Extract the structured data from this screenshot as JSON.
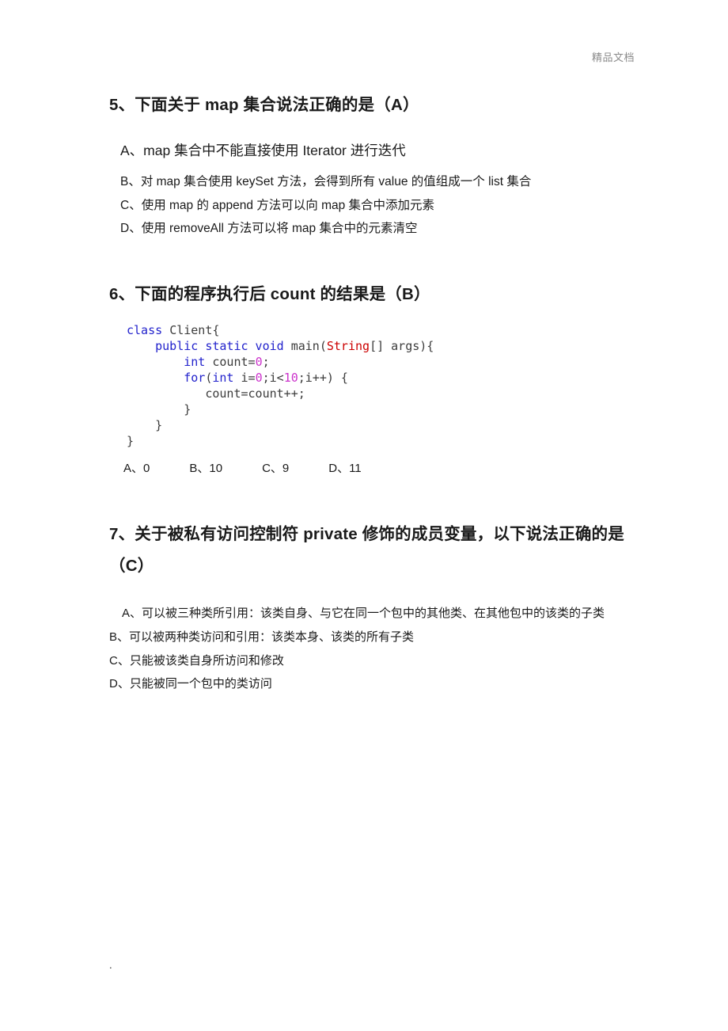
{
  "document": {
    "header_watermark": "精品文档",
    "footer_mark": "."
  },
  "questions": [
    {
      "id": "q5",
      "heading": "5、下面关于 map 集合说法正确的是（A）",
      "answer_key": "A",
      "options": [
        "A、map 集合中不能直接使用 Iterator 进行迭代",
        "B、对 map 集合使用 keySet 方法，会得到所有 value 的值组成一个 list 集合",
        "C、使用 map 的 append 方法可以向 map 集合中添加元素",
        "D、使用 removeAll 方法可以将 map 集合中的元素清空"
      ]
    },
    {
      "id": "q6",
      "heading": "6、下面的程序执行后 count 的结果是（B）",
      "answer_key": "B",
      "code": {
        "language": "java",
        "lines": [
          [
            {
              "t": "class ",
              "c": "kw"
            },
            {
              "t": "Client{",
              "c": "pln"
            }
          ],
          [
            {
              "t": "    ",
              "c": "pln"
            },
            {
              "t": "public static void ",
              "c": "kw"
            },
            {
              "t": "main(",
              "c": "pln"
            },
            {
              "t": "String",
              "c": "type"
            },
            {
              "t": "[] args){",
              "c": "pln"
            }
          ],
          [
            {
              "t": "        ",
              "c": "pln"
            },
            {
              "t": "int ",
              "c": "kw"
            },
            {
              "t": "count=",
              "c": "pln"
            },
            {
              "t": "0",
              "c": "num"
            },
            {
              "t": ";",
              "c": "pln"
            }
          ],
          [
            {
              "t": "        ",
              "c": "pln"
            },
            {
              "t": "for",
              "c": "kw"
            },
            {
              "t": "(",
              "c": "pln"
            },
            {
              "t": "int ",
              "c": "kw"
            },
            {
              "t": "i=",
              "c": "pln"
            },
            {
              "t": "0",
              "c": "num"
            },
            {
              "t": ";i<",
              "c": "pln"
            },
            {
              "t": "10",
              "c": "num"
            },
            {
              "t": ";i++) {",
              "c": "pln"
            }
          ],
          [
            {
              "t": "           count=count++;",
              "c": "pln"
            }
          ],
          [
            {
              "t": "        }",
              "c": "pln"
            }
          ],
          [
            {
              "t": "    }",
              "c": "pln"
            }
          ],
          [
            {
              "t": "}",
              "c": "pln"
            }
          ]
        ]
      },
      "answers_inline": [
        "A、0",
        "B、10",
        "C、9",
        "D、11"
      ]
    },
    {
      "id": "q7",
      "heading": "7、关于被私有访问控制符 private 修饰的成员变量，以下说法正确的是（C）",
      "answer_key": "C",
      "options": [
        "A、可以被三种类所引用：该类自身、与它在同一个包中的其他类、在其他包中的该类的子类",
        "B、可以被两种类访问和引用：该类本身、该类的所有子类",
        "C、只能被该类自身所访问和修改",
        "D、只能被同一个包中的类访问"
      ]
    }
  ],
  "colors": {
    "keyword": "#2222cc",
    "type": "#cc0000",
    "number": "#cc33cc",
    "plain": "#3c3c3c",
    "watermark": "#8a8a8a",
    "text": "#1a1a1a",
    "page_background": "#ffffff"
  }
}
